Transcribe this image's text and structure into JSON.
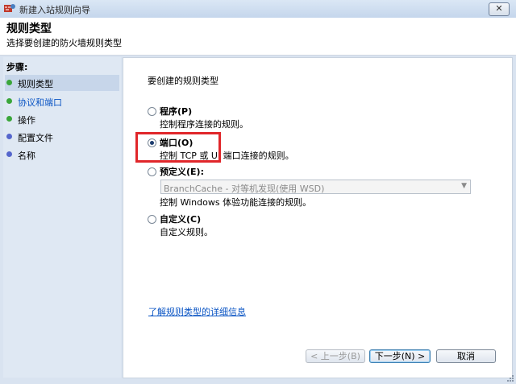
{
  "window": {
    "title": "新建入站规则向导",
    "close_label": "✕"
  },
  "header": {
    "title": "规则类型",
    "subtitle": "选择要创建的防火墙规则类型"
  },
  "sidebar": {
    "title": "步骤:",
    "items": [
      {
        "label": "规则类型",
        "color": "#3aa63a"
      },
      {
        "label": "协议和端口",
        "color": "#3aa63a"
      },
      {
        "label": "操作",
        "color": "#3aa63a"
      },
      {
        "label": "配置文件",
        "color": "#5566cc"
      },
      {
        "label": "名称",
        "color": "#5566cc"
      }
    ]
  },
  "content": {
    "prompt": "要创建的规则类型",
    "options": [
      {
        "title": "程序(P)",
        "desc": "控制程序连接的规则。",
        "selected": false
      },
      {
        "title": "端口(O)",
        "desc": "控制 TCP 或 UI  端口连接的规则。",
        "selected": true
      },
      {
        "title": "预定义(E):",
        "desc": "控制 Windows 体验功能连接的规则。",
        "selected": false
      },
      {
        "title": "自定义(C)",
        "desc": "自定义规则。",
        "selected": false
      }
    ],
    "predefined_select": {
      "value": "BranchCache - 对等机发现(使用 WSD)"
    },
    "help_link": "了解规则类型的详细信息"
  },
  "buttons": {
    "back": "< 上一步(B)",
    "next": "下一步(N) >",
    "cancel": "取消"
  },
  "colors": {
    "highlight": "#e0262a",
    "link": "#0b55c4"
  }
}
